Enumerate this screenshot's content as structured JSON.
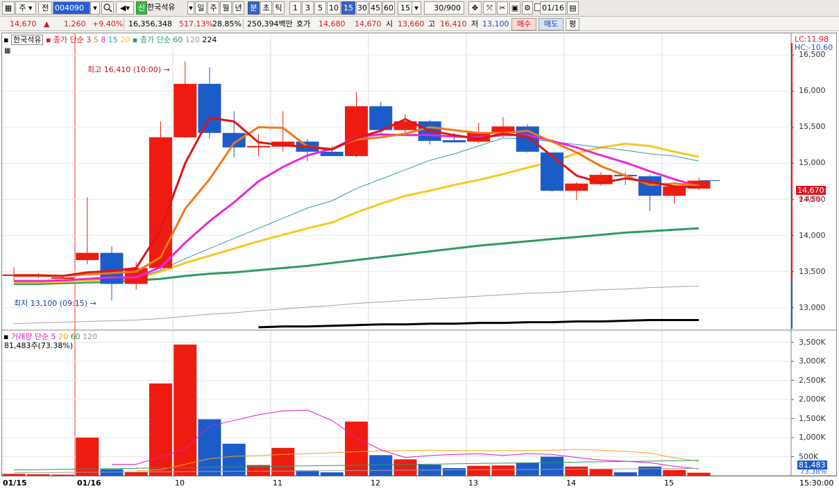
{
  "toolbar": {
    "market": "주",
    "prev_label": "전",
    "code": "004090",
    "search_icon": "magnifier-icon",
    "speaker_icon": "speaker-icon",
    "new_badge": "신",
    "stock_name": "한국석유",
    "periods": [
      "일",
      "주",
      "월",
      "년",
      "분",
      "초",
      "틱"
    ],
    "active_period": "분",
    "intervals": [
      "1",
      "3",
      "5",
      "10",
      "15",
      "30",
      "45",
      "60"
    ],
    "active_interval": "15",
    "interval_select": "15",
    "count": "30",
    "count_total": "/900",
    "date": "01/16",
    "checkbox_label": "0"
  },
  "quote": {
    "price": "14,670",
    "change_arrow": "▲",
    "change": "1,260",
    "change_rate": "+9.40%",
    "volume": "16,356,348",
    "volume_rate": "517.13%",
    "turnover": "28.85%",
    "amount": "250,394백만",
    "hoga_label": "호가",
    "ask": "14,680",
    "bid": "14,670",
    "open_label": "시",
    "open": "13,660",
    "high_label": "고",
    "high": "16,410",
    "low_label": "저",
    "low": "13,100",
    "buy_label": "매수",
    "sell_label": "매도",
    "eval_label": "평"
  },
  "price_legend": {
    "name": "한국석유",
    "ma_title": "종가 단순",
    "ma_periods": [
      "3",
      "5",
      "8",
      "15",
      "20"
    ],
    "ma2_title": "종가 단순",
    "ma2_periods": [
      "60",
      "120",
      "224"
    ]
  },
  "volume_legend": {
    "title": "거래량 단순",
    "periods": [
      "5",
      "20",
      "60",
      "120"
    ],
    "current": "81,483주(73.38%)"
  },
  "annotations": {
    "high_text": "최고 16,410 (10:00)",
    "low_text": "최저 13,100 (09:15)",
    "lc": "LC:11.98",
    "hc": "HC:-10.60",
    "price_badge": "14,670",
    "rate_badge": "9.40%",
    "vol_badge": "81,483",
    "vol_rate_badge": "73.38%"
  },
  "x_axis": {
    "date_labels": [
      "01/15",
      "01/16"
    ],
    "hour_labels": [
      "10",
      "11",
      "12",
      "13",
      "14",
      "15"
    ],
    "end_time": "15:30:00"
  },
  "colors": {
    "up": "#ee1c10",
    "down": "#1c5cc8",
    "ma3": "#e01414",
    "ma5": "#f07818",
    "ma8": "#e828d8",
    "ma15": "#2a9ab0",
    "ma20": "#f8c820",
    "ma60": "#2e9a62"
  },
  "chart_data": [
    {
      "type": "candlestick",
      "interval": "15min",
      "y_ticks": [
        "16,500",
        "16,000",
        "15,500",
        "15,000",
        "14,500",
        "14,000",
        "13,500",
        "13,000"
      ],
      "ylim": [
        12700,
        16800
      ],
      "candles": [
        {
          "t": "01/15 15:00",
          "o": 13440,
          "h": 13560,
          "l": 13380,
          "c": 13460
        },
        {
          "t": "01/15 15:15",
          "o": 13440,
          "h": 13480,
          "l": 13410,
          "c": 13450
        },
        {
          "t": "01/15 15:30",
          "o": 13410,
          "h": 13450,
          "l": 13400,
          "c": 13420
        },
        {
          "t": "01/16 09:00",
          "o": 13660,
          "h": 14530,
          "l": 13600,
          "c": 13760
        },
        {
          "t": "01/16 09:15",
          "o": 13760,
          "h": 13850,
          "l": 13100,
          "c": 13330
        },
        {
          "t": "01/16 09:30",
          "o": 13330,
          "h": 13630,
          "l": 13250,
          "c": 13550
        },
        {
          "t": "01/16 09:45",
          "o": 13550,
          "h": 15580,
          "l": 13530,
          "c": 15360
        },
        {
          "t": "01/16 10:00",
          "o": 15360,
          "h": 16410,
          "l": 15350,
          "c": 16100
        },
        {
          "t": "01/16 10:15",
          "o": 16100,
          "h": 16330,
          "l": 15340,
          "c": 15420
        },
        {
          "t": "01/16 10:30",
          "o": 15420,
          "h": 15720,
          "l": 15080,
          "c": 15220
        },
        {
          "t": "01/16 10:45",
          "o": 15220,
          "h": 15400,
          "l": 15100,
          "c": 15240
        },
        {
          "t": "01/16 11:00",
          "o": 15230,
          "h": 15720,
          "l": 15160,
          "c": 15300
        },
        {
          "t": "01/16 11:15",
          "o": 15300,
          "h": 15330,
          "l": 15030,
          "c": 15160
        },
        {
          "t": "01/16 11:30",
          "o": 15160,
          "h": 15240,
          "l": 15100,
          "c": 15100
        },
        {
          "t": "01/16 11:45",
          "o": 15100,
          "h": 15990,
          "l": 15080,
          "c": 15790
        },
        {
          "t": "01/16 12:00",
          "o": 15790,
          "h": 15850,
          "l": 15400,
          "c": 15460
        },
        {
          "t": "01/16 12:15",
          "o": 15460,
          "h": 15680,
          "l": 15400,
          "c": 15580
        },
        {
          "t": "01/16 12:30",
          "o": 15580,
          "h": 15600,
          "l": 15260,
          "c": 15310
        },
        {
          "t": "01/16 12:45",
          "o": 15320,
          "h": 15420,
          "l": 15290,
          "c": 15290
        },
        {
          "t": "01/16 13:00",
          "o": 15300,
          "h": 15560,
          "l": 15280,
          "c": 15430
        },
        {
          "t": "01/16 13:15",
          "o": 15420,
          "h": 15640,
          "l": 15360,
          "c": 15510
        },
        {
          "t": "01/16 13:30",
          "o": 15510,
          "h": 15540,
          "l": 15150,
          "c": 15160
        },
        {
          "t": "01/16 13:45",
          "o": 15150,
          "h": 15150,
          "l": 14610,
          "c": 14620
        },
        {
          "t": "01/16 14:00",
          "o": 14620,
          "h": 14740,
          "l": 14490,
          "c": 14720
        },
        {
          "t": "01/16 14:15",
          "o": 14710,
          "h": 14880,
          "l": 14690,
          "c": 14840
        },
        {
          "t": "01/16 14:30",
          "o": 14840,
          "h": 14880,
          "l": 14700,
          "c": 14820
        },
        {
          "t": "01/16 14:45",
          "o": 14820,
          "h": 14840,
          "l": 14340,
          "c": 14550
        },
        {
          "t": "01/16 15:00",
          "o": 14550,
          "h": 14700,
          "l": 14440,
          "c": 14680
        },
        {
          "t": "01/16 15:15",
          "o": 14650,
          "h": 14800,
          "l": 14630,
          "c": 14760
        }
      ],
      "ma3": [
        13450,
        13450,
        13440,
        13490,
        13510,
        13550,
        14080,
        15000,
        15630,
        15580,
        15290,
        15250,
        15230,
        15190,
        15350,
        15450,
        15610,
        15450,
        15390,
        15340,
        15410,
        15370,
        15100,
        14830,
        14730,
        14790,
        14740,
        14680,
        14670
      ],
      "ma5": [
        13440,
        13440,
        13440,
        13460,
        13480,
        13500,
        13700,
        14370,
        14780,
        15280,
        15500,
        15490,
        15230,
        15200,
        15330,
        15360,
        15410,
        15500,
        15460,
        15420,
        15420,
        15450,
        15300,
        15150,
        14960,
        14830,
        14700,
        14720,
        14690
      ],
      "ma8": [
        13370,
        13370,
        13380,
        13400,
        13420,
        13420,
        13560,
        13900,
        14200,
        14460,
        14750,
        14950,
        15110,
        15200,
        15360,
        15400,
        15390,
        15390,
        15370,
        15360,
        15390,
        15390,
        15310,
        15220,
        15110,
        15010,
        14890,
        14780,
        14680
      ],
      "ma15": [
        13380,
        13380,
        13380,
        13390,
        13400,
        13410,
        13520,
        13680,
        13820,
        13960,
        14100,
        14240,
        14380,
        14480,
        14650,
        14780,
        14910,
        15040,
        15130,
        15240,
        15350,
        15340,
        15300,
        15260,
        15220,
        15180,
        15130,
        15100,
        15030
      ],
      "ma20": [
        13350,
        13350,
        13360,
        13370,
        13380,
        13400,
        13500,
        13620,
        13720,
        13820,
        13920,
        14010,
        14100,
        14180,
        14320,
        14440,
        14550,
        14620,
        14700,
        14770,
        14850,
        14940,
        15020,
        15140,
        15220,
        15270,
        15240,
        15160,
        15090
      ],
      "ma60": [
        13330,
        13330,
        13340,
        13350,
        13360,
        13380,
        13400,
        13440,
        13470,
        13490,
        13520,
        13550,
        13580,
        13620,
        13660,
        13700,
        13740,
        13780,
        13820,
        13860,
        13890,
        13920,
        13950,
        13980,
        14010,
        14040,
        14060,
        14080,
        14100
      ],
      "ma120": [
        12780,
        12790,
        12800,
        12810,
        12820,
        12830,
        12850,
        12880,
        12910,
        12930,
        12960,
        12980,
        13010,
        13030,
        13060,
        13080,
        13100,
        13120,
        13140,
        13160,
        13180,
        13200,
        13210,
        13230,
        13250,
        13260,
        13280,
        13290,
        13300
      ],
      "ma224": [
        null,
        null,
        null,
        null,
        null,
        null,
        null,
        null,
        null,
        null,
        12730,
        12740,
        12740,
        12750,
        12760,
        12770,
        12770,
        12780,
        12780,
        12790,
        12790,
        12800,
        12800,
        12810,
        12810,
        12820,
        12830,
        12830,
        12830
      ]
    },
    {
      "type": "bar",
      "title": "거래량",
      "y_ticks": [
        "3,500K",
        "3,000K",
        "2,500K",
        "2,000K",
        "1,500K",
        "1,000K",
        "500K"
      ],
      "ylim": [
        0,
        3800
      ],
      "volumes_k": [
        50,
        40,
        30,
        1000,
        170,
        90,
        2420,
        3440,
        1480,
        840,
        280,
        730,
        140,
        90,
        1420,
        540,
        430,
        290,
        200,
        260,
        270,
        340,
        500,
        240,
        170,
        90,
        240,
        150,
        80
      ],
      "vma5": [
        null,
        null,
        null,
        null,
        300,
        300,
        500,
        700,
        1300,
        1450,
        1600,
        1700,
        1720,
        1450,
        1000,
        680,
        480,
        530,
        560,
        580,
        530,
        580,
        560,
        480,
        410,
        380,
        340,
        250,
        180
      ],
      "vma20": [
        null,
        null,
        null,
        null,
        null,
        130,
        160,
        300,
        450,
        510,
        530,
        560,
        580,
        600,
        630,
        650,
        660,
        670,
        660,
        660,
        660,
        660,
        670,
        690,
        670,
        640,
        590,
        470,
        380
      ],
      "vma60": [
        null,
        null,
        null,
        null,
        null,
        null,
        null,
        null,
        null,
        null,
        null,
        null,
        null,
        null,
        null,
        null,
        null,
        null,
        null,
        null,
        null,
        null,
        null,
        null,
        null,
        null,
        null,
        null,
        null
      ]
    }
  ]
}
